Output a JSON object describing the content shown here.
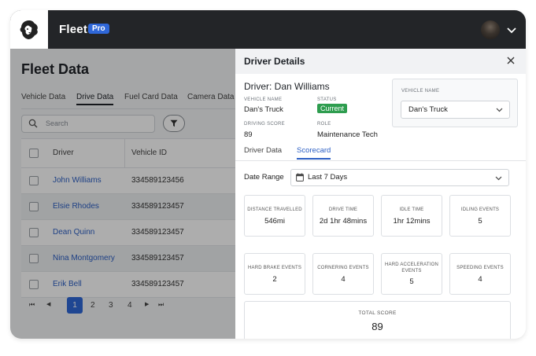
{
  "header": {
    "brand": "Fleet",
    "badge": "Pro"
  },
  "page": {
    "title": "Fleet Data",
    "tabs": [
      {
        "label": "Vehicle Data",
        "active": false
      },
      {
        "label": "Drive Data",
        "active": true
      },
      {
        "label": "Fuel Card Data",
        "active": false
      },
      {
        "label": "Camera Data",
        "active": false
      }
    ],
    "search_placeholder": "Search",
    "table": {
      "columns": [
        "Driver",
        "Vehicle ID"
      ],
      "rows": [
        {
          "driver": "John Williams",
          "vehicle_id": "334589123456"
        },
        {
          "driver": "Elsie Rhodes",
          "vehicle_id": "334589123457"
        },
        {
          "driver": "Dean Quinn",
          "vehicle_id": "334589123457"
        },
        {
          "driver": "Nina Montgomery",
          "vehicle_id": "334589123457"
        },
        {
          "driver": "Erik Bell",
          "vehicle_id": "334589123457"
        }
      ]
    },
    "pagination": {
      "first": "⏮",
      "prev": "◀",
      "pages": [
        "1",
        "2",
        "3",
        "4"
      ],
      "current": "1",
      "next": "▶",
      "last": "⏭"
    }
  },
  "drawer": {
    "title": "Driver Details",
    "driver_heading": "Driver: Dan Williams",
    "vehicle_name_label": "VEHICLE NAME",
    "vehicle_name": "Dan's Truck",
    "status_label": "STATUS",
    "status": "Current",
    "driving_score_label": "DRIVING SCORE",
    "driving_score": "89",
    "role_label": "ROLE",
    "role": "Maintenance Tech",
    "vehicle_select_label": "VEHICLE NAME",
    "vehicle_select_value": "Dan's Truck",
    "tabs": [
      {
        "label": "Driver Data",
        "active": false
      },
      {
        "label": "Scorecard",
        "active": true
      }
    ],
    "date_range_label": "Date Range",
    "date_range_value": "Last 7 Days",
    "metrics": [
      {
        "label": "DISTANCE TRAVELLED",
        "value": "546mi"
      },
      {
        "label": "DRIVE TIME",
        "value": "2d 1hr 48mins"
      },
      {
        "label": "IDLE TIME",
        "value": "1hr 12mins"
      },
      {
        "label": "IDLING EVENTS",
        "value": "5"
      },
      {
        "label": "HARD BRAKE EVENTS",
        "value": "2"
      },
      {
        "label": "CORNERING EVENTS",
        "value": "4"
      },
      {
        "label": "HARD ACCELERATION EVENTS",
        "value": "5"
      },
      {
        "label": "SPEEDING EVENTS",
        "value": "4"
      }
    ],
    "total_label": "TOTAL SCORE",
    "total_value": "89"
  },
  "colors": {
    "header_bg": "#232528",
    "accent": "#2f67d8",
    "status_green": "#2e9d4f",
    "link": "#2c5fc4"
  },
  "icons": {
    "logo": "lion-logo-icon",
    "avatar": "user-avatar",
    "account_menu": "chevron-down-icon",
    "search": "search-icon",
    "filter": "filter-icon",
    "close": "close-icon",
    "calendar": "calendar-icon"
  }
}
